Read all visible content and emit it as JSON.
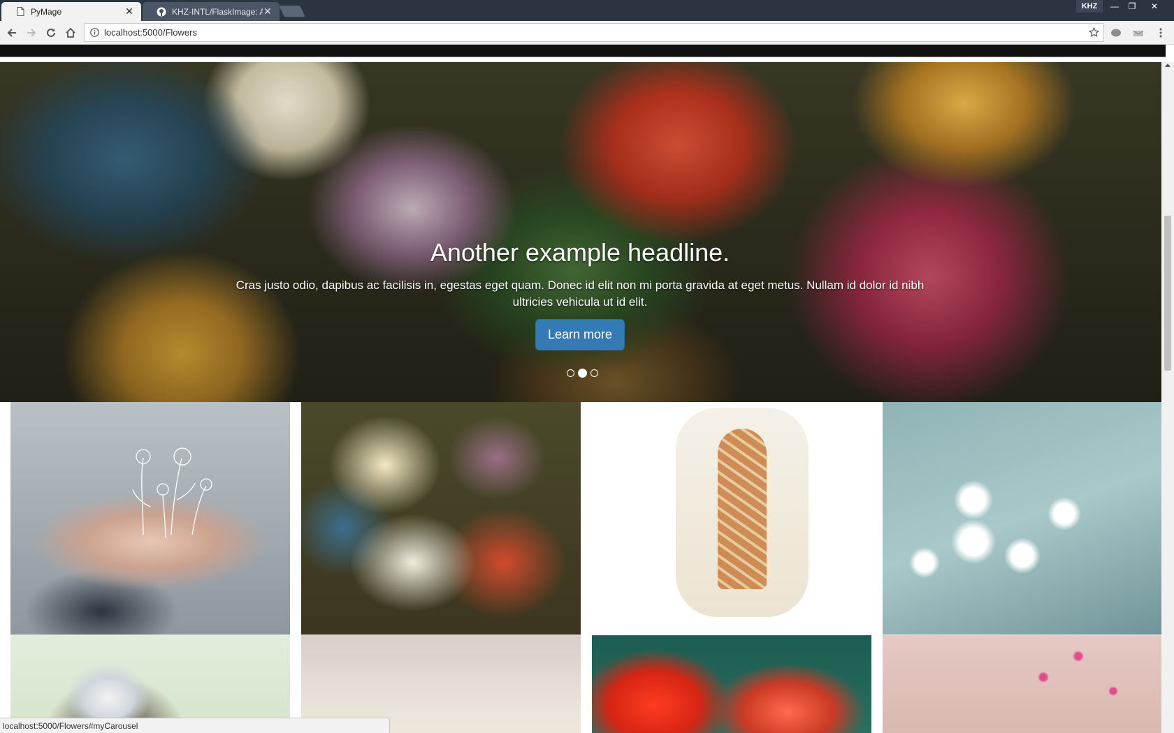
{
  "browser": {
    "tabs": [
      {
        "title": "PyMage",
        "active": true,
        "icon": "page-icon"
      },
      {
        "title": "KHZ-INTL/FlaskImage: A",
        "active": false,
        "icon": "github-icon"
      }
    ],
    "profile": "KHZ",
    "url": "localhost:5000/Flowers",
    "status_url": "localhost:5000/Flowers#myCarousel"
  },
  "carousel": {
    "headline": "Another example headline.",
    "body": "Cras justo odio, dapibus ac facilisis in, egestas eget quam. Donec id elit non mi porta gravida at eget metus. Nullam id dolor id nibh ultricies vehicula ut id elit.",
    "button_label": "Learn more",
    "slide_count": 3,
    "active_slide": 2
  },
  "colors": {
    "primary_button": "#337ab7",
    "chrome_dark": "#2b3441"
  }
}
